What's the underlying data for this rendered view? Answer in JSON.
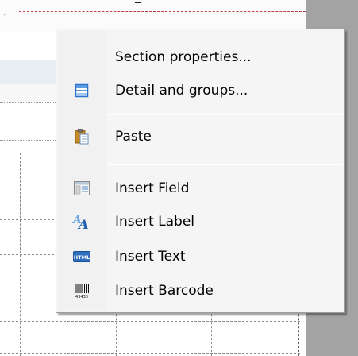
{
  "context_menu": {
    "items": [
      {
        "label": "Section properties...",
        "icon": "none"
      },
      {
        "label": "Detail and groups...",
        "icon": "detail-groups-icon"
      },
      {
        "label": "Paste",
        "icon": "clipboard-paste-icon"
      },
      {
        "label": "Insert Field",
        "icon": "field-table-icon"
      },
      {
        "label": "Insert Label",
        "icon": "label-text-icon"
      },
      {
        "label": "Insert Text",
        "icon": "html-text-icon"
      },
      {
        "label": "Insert Barcode",
        "icon": "barcode-icon"
      }
    ],
    "html_badge": "HTML",
    "barcode_digits": "43433"
  },
  "colors": {
    "menu_background": "#f5f5f5",
    "right_panel": "#a3a3a3",
    "section_border": "#c0404a"
  }
}
